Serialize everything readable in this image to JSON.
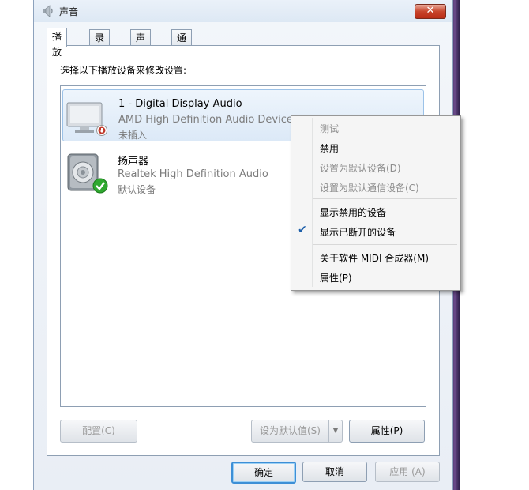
{
  "window": {
    "title": "声音",
    "close_glyph": "✕"
  },
  "tabs": [
    {
      "label": "播放",
      "active": true
    },
    {
      "label": "录制",
      "active": false
    },
    {
      "label": "声音",
      "active": false
    },
    {
      "label": "通信",
      "active": false
    }
  ],
  "instruction": "选择以下播放设备来修改设置:",
  "devices": [
    {
      "name": "1 - Digital Display Audio",
      "description": "AMD High Definition Audio Device",
      "status": "未插入",
      "icon": "monitor-icon",
      "status_icon": "unplugged-icon"
    },
    {
      "name": "扬声器",
      "description": "Realtek High Definition Audio",
      "status": "默认设备",
      "icon": "speaker-icon",
      "status_icon": "default-check-icon"
    }
  ],
  "context_menu": {
    "items": [
      {
        "label": "测试",
        "enabled": false
      },
      {
        "label": "禁用",
        "enabled": true
      },
      {
        "label": "设置为默认设备(D)",
        "enabled": false
      },
      {
        "label": "设置为默认通信设备(C)",
        "enabled": false
      },
      {
        "label": "显示禁用的设备",
        "enabled": true,
        "checked": false
      },
      {
        "label": "显示已断开的设备",
        "enabled": true,
        "checked": true
      },
      {
        "label": "关于软件 MIDI 合成器(M)",
        "enabled": true
      },
      {
        "label": "属性(P)",
        "enabled": true
      }
    ],
    "check_glyph": "✔"
  },
  "buttons": {
    "configure": "配置(C)",
    "set_default": "设为默认值(S)",
    "set_default_arrow": "▼",
    "properties": "属性(P)",
    "ok": "确定",
    "cancel": "取消",
    "apply": "应用 (A)"
  },
  "colors": {
    "accent": "#3d8fd6",
    "selection": "#dce9f7",
    "default_check": "#2fa82f",
    "unplugged_badge": "#c0392b"
  }
}
